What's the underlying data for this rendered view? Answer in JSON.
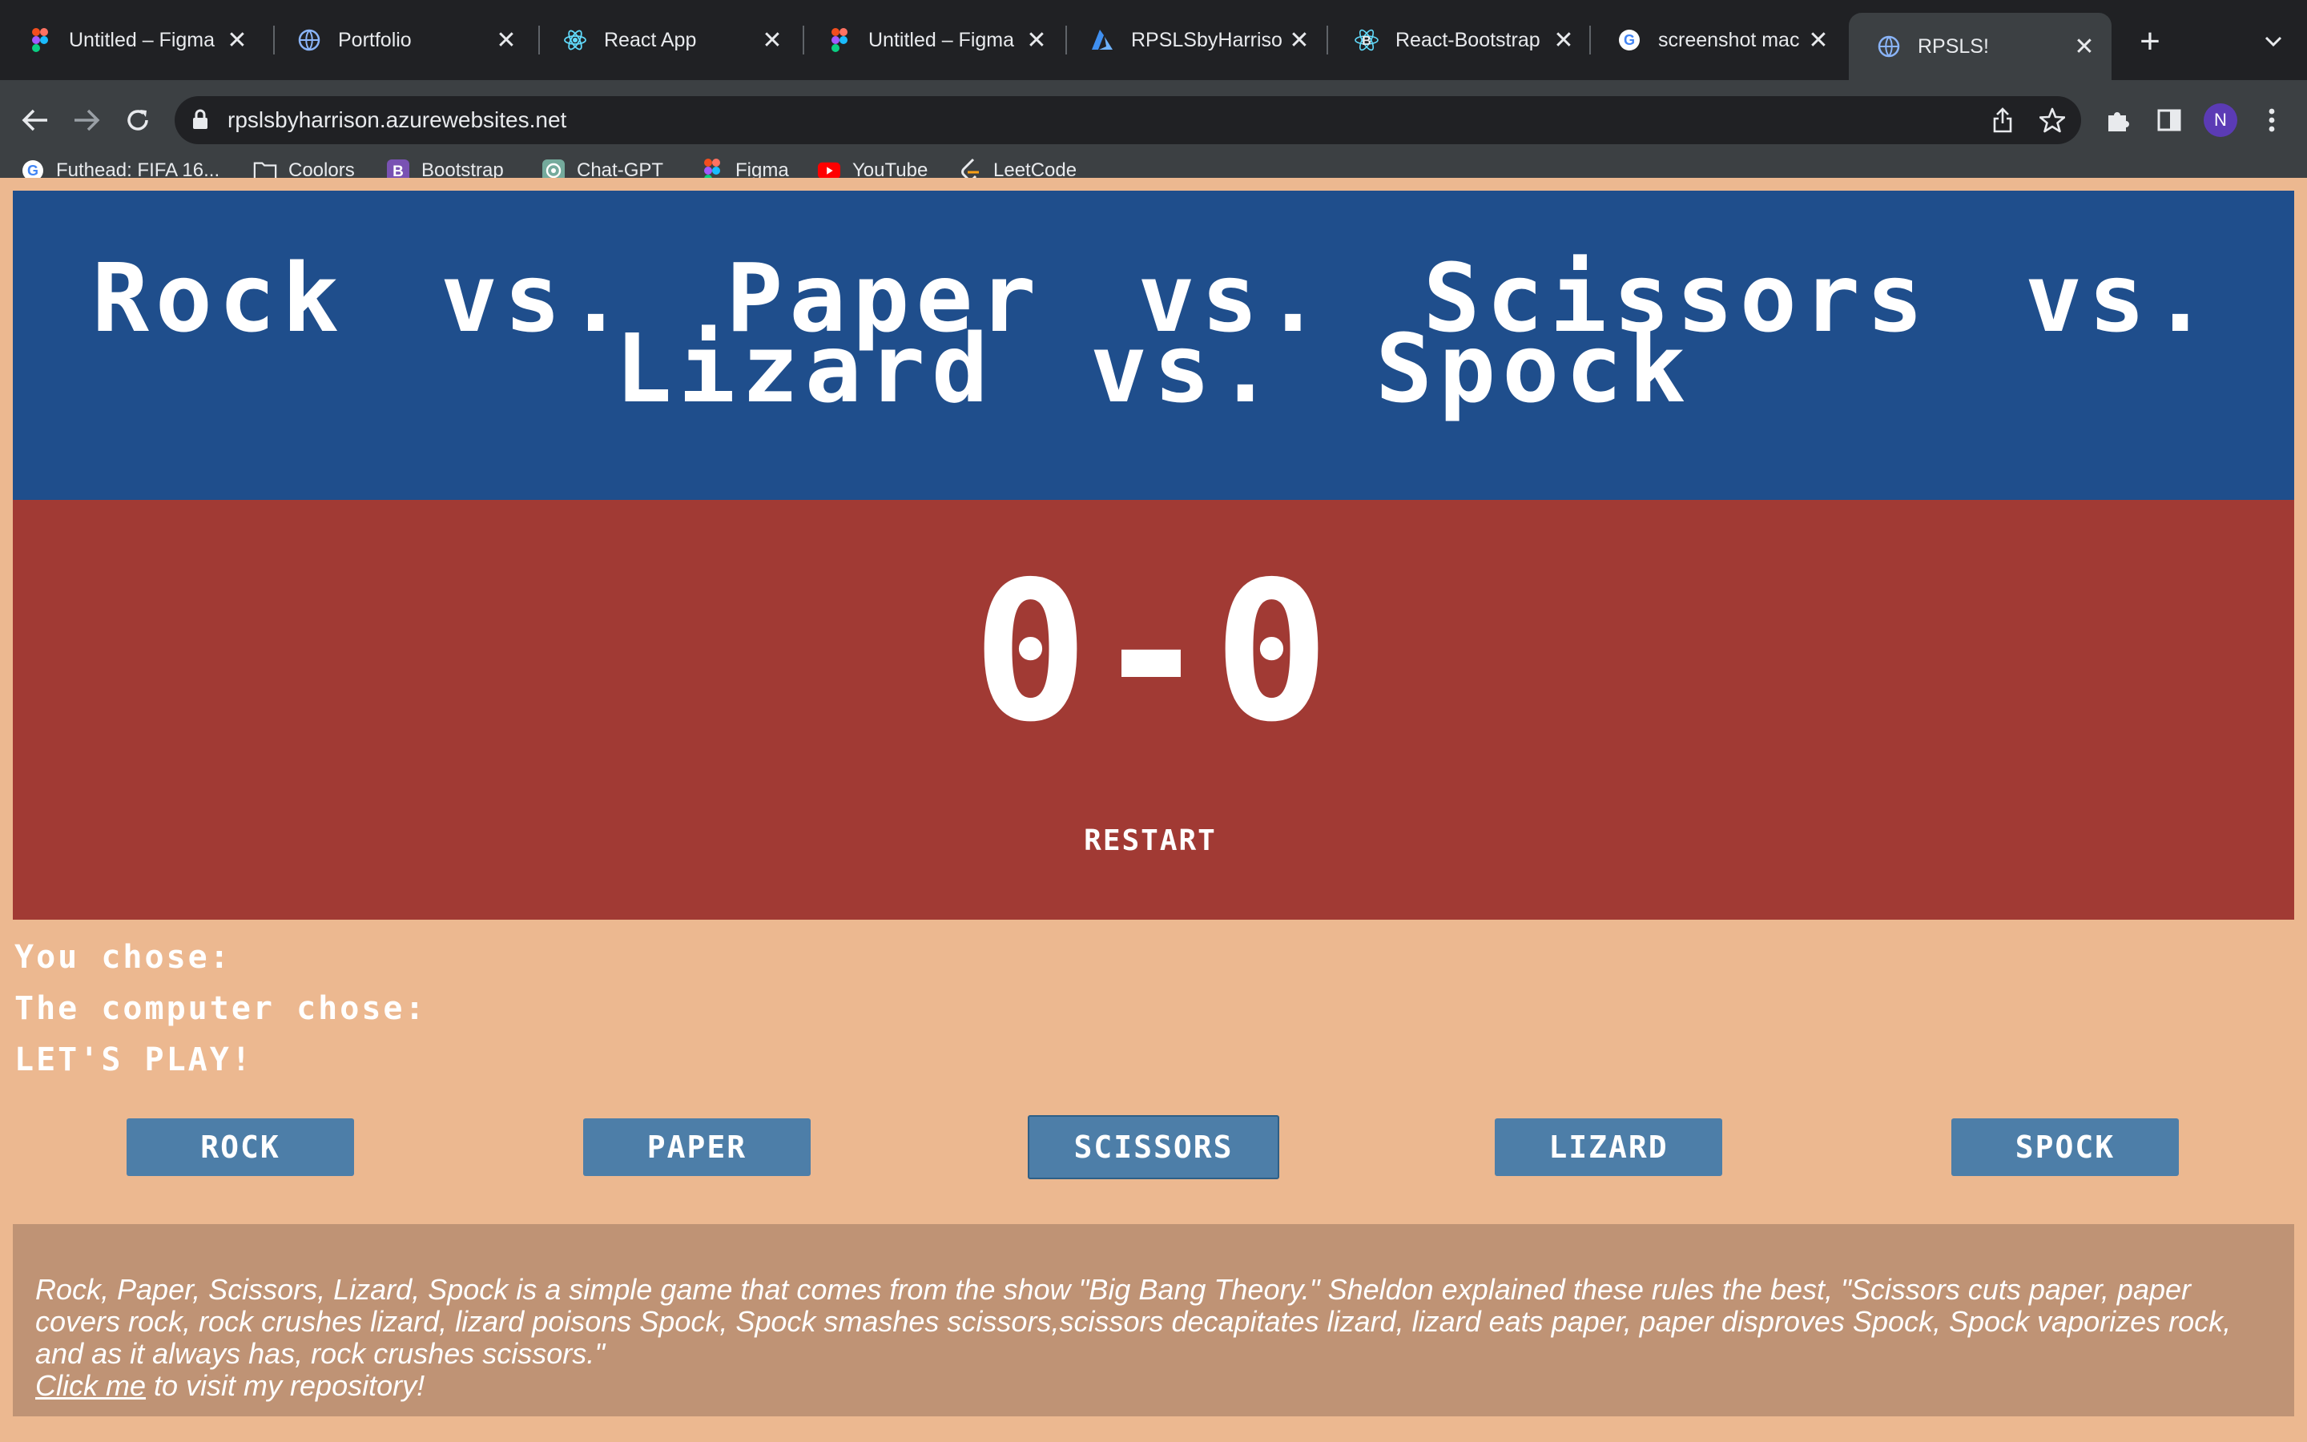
{
  "browser": {
    "tabs": [
      {
        "title": "Untitled – Figma",
        "icon": "figma-icon"
      },
      {
        "title": "Portfolio",
        "icon": "globe-icon"
      },
      {
        "title": "React App",
        "icon": "react-icon"
      },
      {
        "title": "Untitled – Figma",
        "icon": "figma-icon"
      },
      {
        "title": "RPSLSbyHarrison",
        "icon": "azure-icon"
      },
      {
        "title": "React-Bootstrap",
        "icon": "react-bootstrap-icon"
      },
      {
        "title": "screenshot mac -",
        "icon": "google-icon"
      },
      {
        "title": "RPSLS!",
        "icon": "globe-icon",
        "active": true
      }
    ],
    "url": "rpslsbyharrison.azurewebsites.net",
    "profile_initial": "N",
    "bookmarks": [
      {
        "label": "Futhead: FIFA 16...",
        "icon": "google-icon"
      },
      {
        "label": "Coolors",
        "icon": "folder-icon"
      },
      {
        "label": "Bootstrap",
        "icon": "bootstrap-icon"
      },
      {
        "label": "Chat-GPT",
        "icon": "chatgpt-icon"
      },
      {
        "label": "Figma",
        "icon": "figma-icon"
      },
      {
        "label": "YouTube",
        "icon": "youtube-icon"
      },
      {
        "label": "LeetCode",
        "icon": "leetcode-icon"
      }
    ]
  },
  "game": {
    "title": "Rock vs. Paper vs. Scissors vs. Lizard vs. Spock",
    "score": "0-0",
    "restart_label": "RESTART",
    "you_chose": "You chose:",
    "computer_chose": "The computer chose:",
    "result": "LET'S PLAY!",
    "choices": [
      "ROCK",
      "PAPER",
      "SCISSORS",
      "LIZARD",
      "SPOCK"
    ]
  },
  "footer": {
    "text": "Rock, Paper, Scissors, Lizard, Spock is a simple game that comes from the show \"Big Bang Theory.\" Sheldon explained these rules the best, \"Scissors cuts paper, paper covers rock, rock crushes lizard, lizard poisons Spock, Spock smashes scissors,scissors decapitates lizard, lizard eats paper, paper disproves Spock, Spock vaporizes rock, and as it always has, rock crushes scissors.\"",
    "link_text": "Click me",
    "link_suffix": " to visit my repository!"
  },
  "colors": {
    "page_bg": "#ecb890",
    "header_bg": "#1f4e8c",
    "score_bg": "#a13a34",
    "button_bg": "#4d7ea8",
    "footer_bg": "#bf9375"
  }
}
